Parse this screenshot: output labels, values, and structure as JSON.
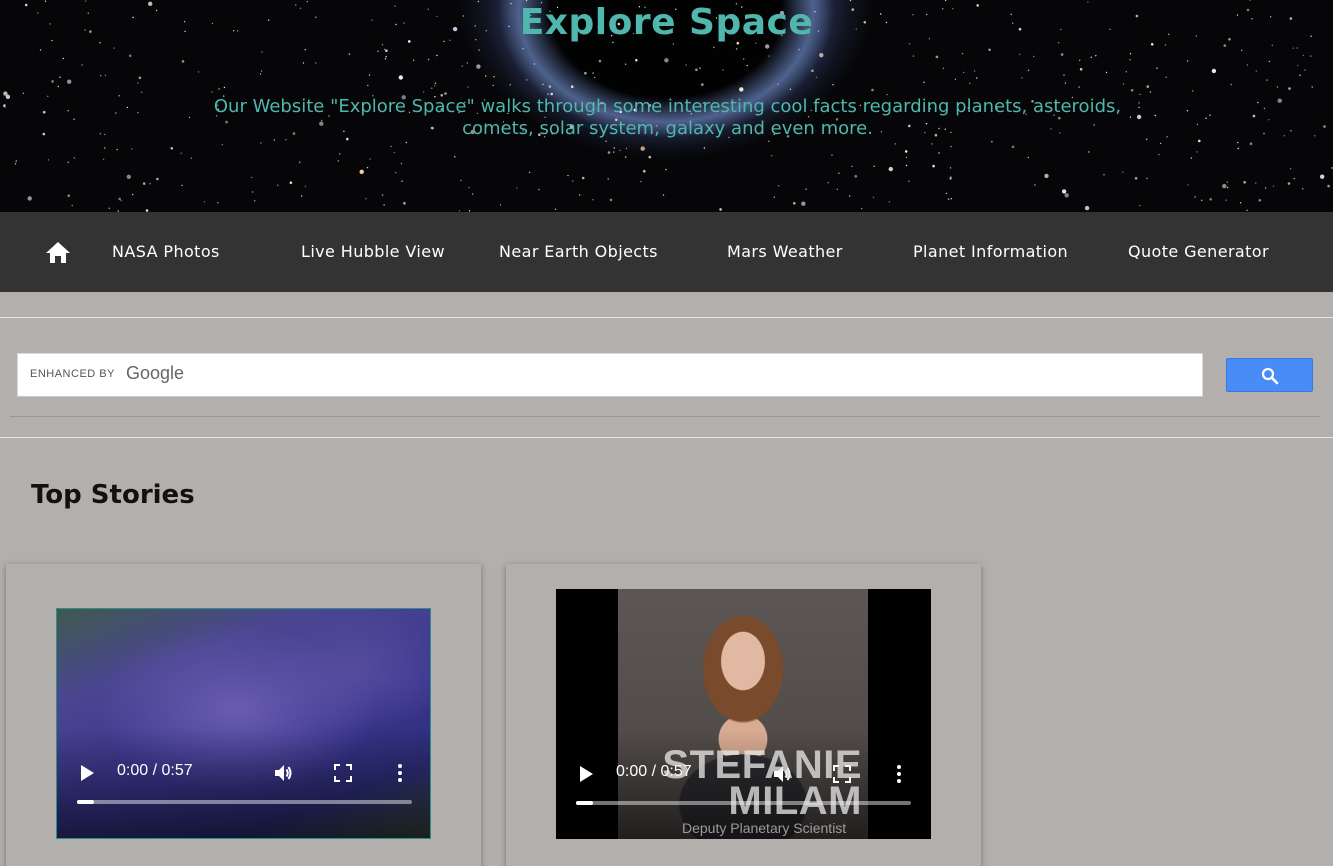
{
  "header": {
    "title": "Explore Space",
    "description": "Our Website \"Explore Space\" walks through some interesting cool facts regarding planets, asteroids, comets, solar system, galaxy and even more."
  },
  "nav": {
    "home_icon": "home-icon",
    "items": [
      {
        "label": "NASA Photos"
      },
      {
        "label": "Live Hubble View"
      },
      {
        "label": "Near Earth Objects"
      },
      {
        "label": "Mars Weather"
      },
      {
        "label": "Planet Information"
      },
      {
        "label": "Quote Generator"
      }
    ]
  },
  "search": {
    "enhanced_label": "ENHANCED BY",
    "brand": "Google",
    "button_icon": "search-icon",
    "button_color": "#4a8cf6"
  },
  "main": {
    "section_title": "Top Stories",
    "videos": [
      {
        "time": "0:00 / 0:57",
        "progress": 0.05
      },
      {
        "time": "0:00 / 0:57",
        "progress": 0.05,
        "overlay_name": "STEFANIE MILAM",
        "overlay_subtitle": "Deputy Planetary Scientist"
      }
    ]
  },
  "colors": {
    "accent": "#4fb7ad",
    "nav_bg": "#333333",
    "page_bg": "#b3afad"
  }
}
